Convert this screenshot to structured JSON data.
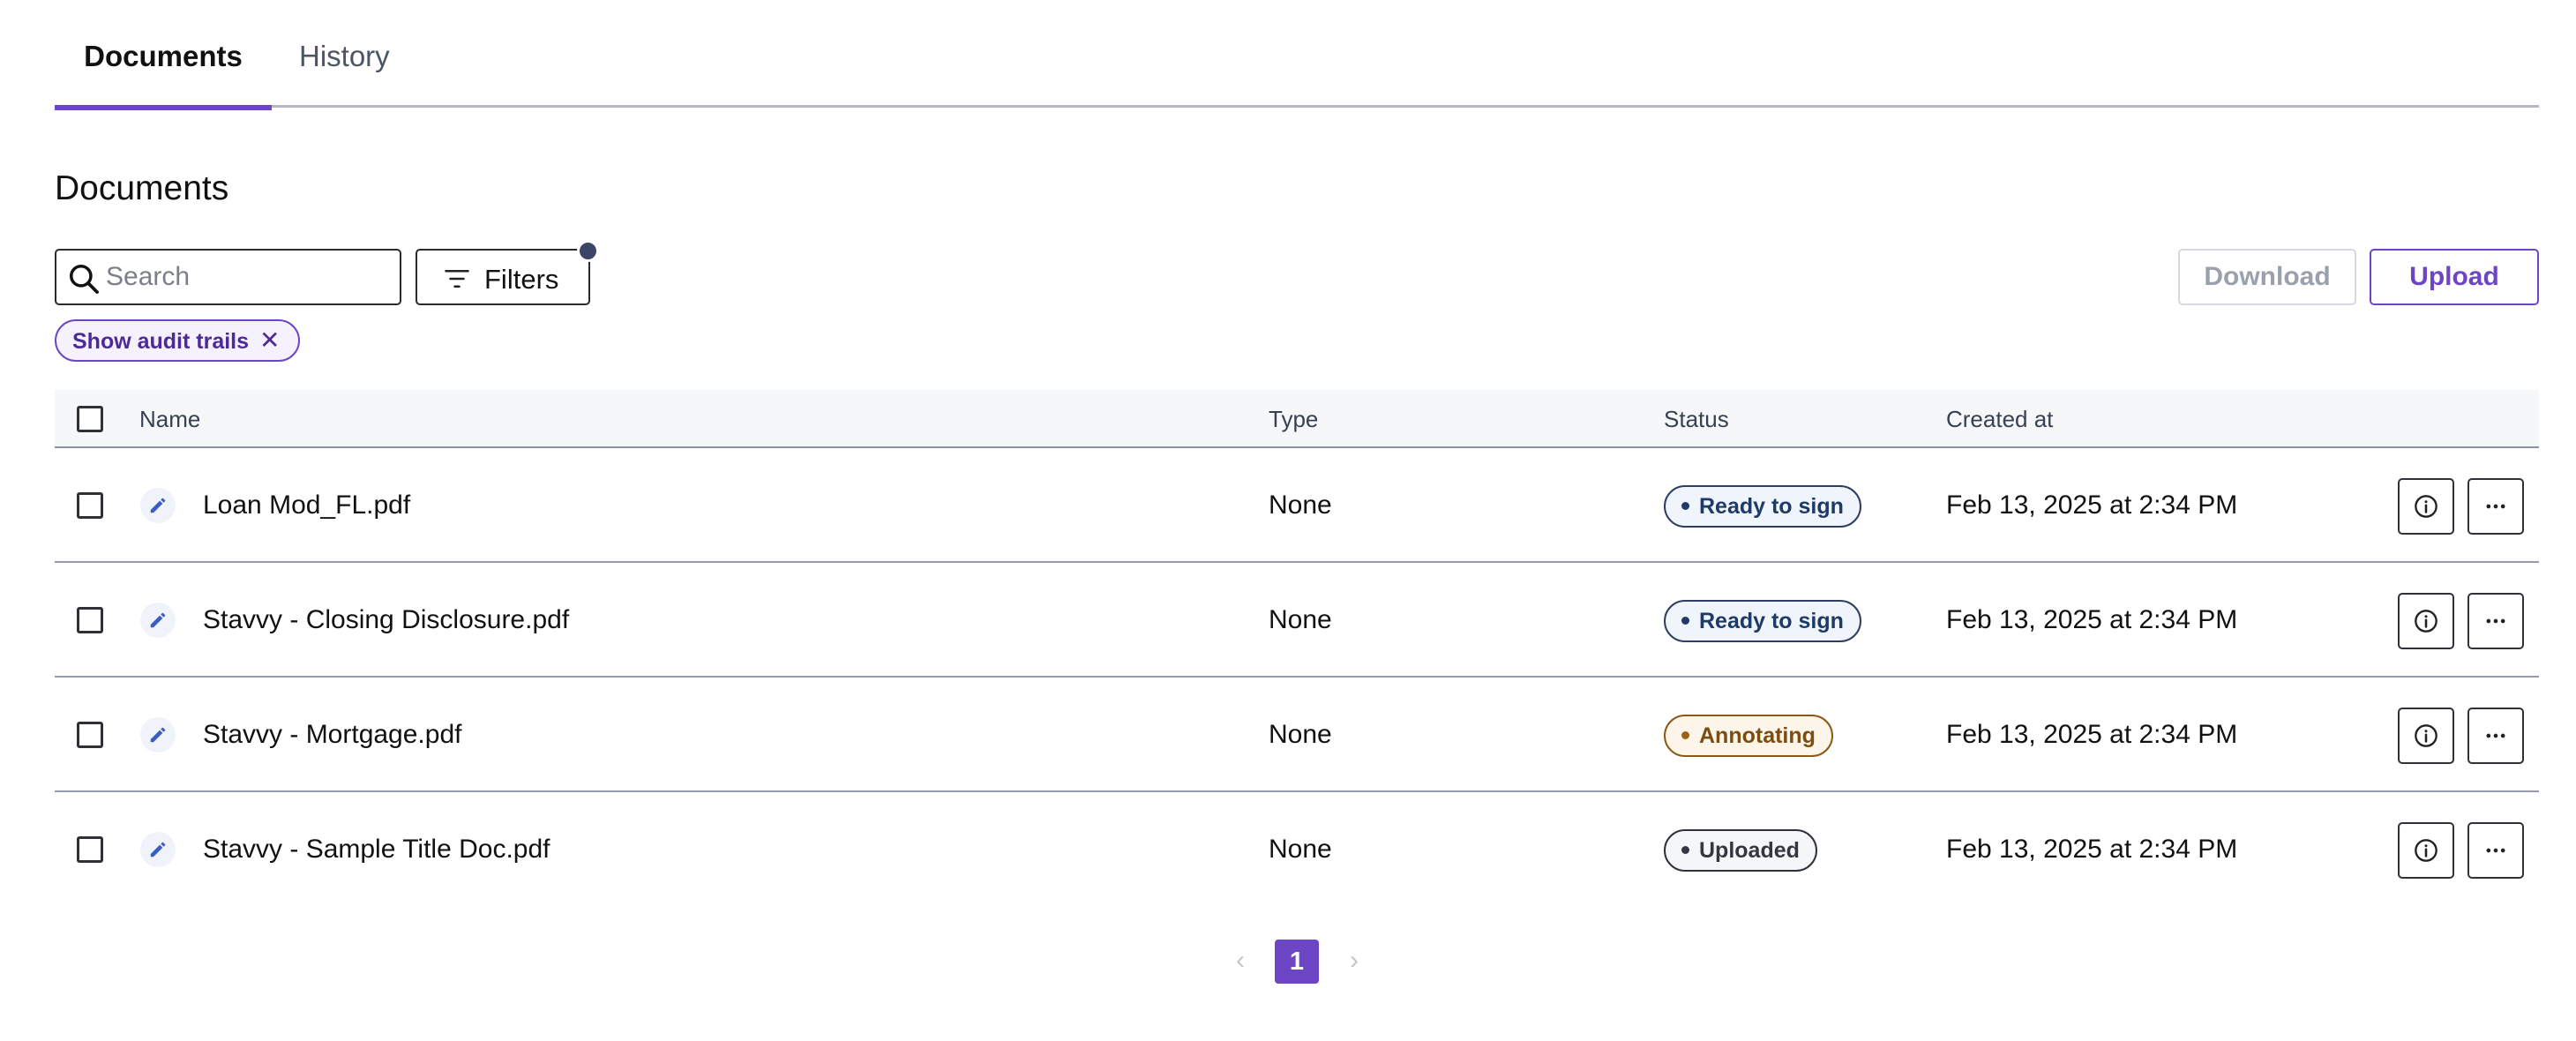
{
  "tabs": [
    {
      "label": "Documents",
      "active": true
    },
    {
      "label": "History",
      "active": false
    }
  ],
  "section_title": "Documents",
  "toolbar": {
    "search_placeholder": "Search",
    "search_value": "",
    "filters_label": "Filters",
    "download_label": "Download",
    "upload_label": "Upload"
  },
  "chips": [
    {
      "label": "Show audit trails",
      "close_glyph": "✕"
    }
  ],
  "table": {
    "columns": [
      "Name",
      "Type",
      "Status",
      "Created at"
    ],
    "rows": [
      {
        "name": "Loan Mod_FL.pdf",
        "type": "None",
        "status": "Ready to sign",
        "created_at": "Feb 13, 2025 at 2:34 PM"
      },
      {
        "name": "Stavvy - Closing Disclosure.pdf",
        "type": "None",
        "status": "Ready to sign",
        "created_at": "Feb 13, 2025 at 2:34 PM"
      },
      {
        "name": "Stavvy - Mortgage.pdf",
        "type": "None",
        "status": "Annotating",
        "created_at": "Feb 13, 2025 at 2:34 PM"
      },
      {
        "name": "Stavvy - Sample Title Doc.pdf",
        "type": "None",
        "status": "Uploaded",
        "created_at": "Feb 13, 2025 at 2:34 PM"
      }
    ]
  },
  "pagination": {
    "prev_glyph": "‹",
    "current_page": "1",
    "next_glyph": "›"
  },
  "icons": {
    "search": "search-icon",
    "filter": "filter-icon",
    "edit": "pencil-icon",
    "info": "info-icon",
    "more": "more-horizontal-icon",
    "close": "close-icon"
  },
  "colors": {
    "accent": "#6d46c6",
    "ready_to_sign": "#1e3a66",
    "annotating": "#7a4d10",
    "uploaded": "#333740"
  }
}
